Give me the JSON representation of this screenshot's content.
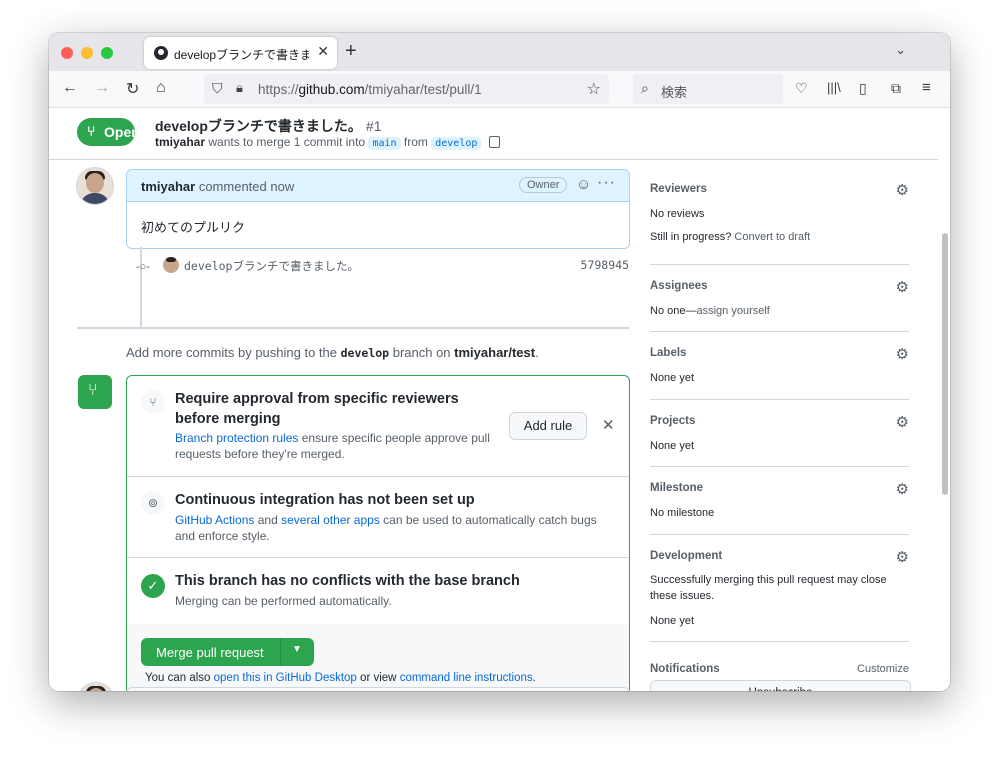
{
  "browser": {
    "tab_title": "developブランチで書きました。",
    "url_prefix": "https://",
    "url_host": "github.com",
    "url_path": "/tmiyahar/test/pull/1",
    "search_placeholder": "検索"
  },
  "pr": {
    "state": "Open",
    "title": "developブランチで書きました。",
    "number": "#1",
    "author": "tmiyahar",
    "meta_text": "wants to merge 1 commit into",
    "base_branch": "main",
    "from_text": "from",
    "head_branch": "develop"
  },
  "comment": {
    "author": "tmiyahar",
    "action": "commented now",
    "role": "Owner",
    "body": "初めてのプルリク"
  },
  "commit": {
    "message": "developブランチで書きました。",
    "sha": "5798945"
  },
  "push_note": {
    "prefix": "Add more commits by pushing to the",
    "branch": "develop",
    "middle": "branch on",
    "repo": "tmiyahar/test",
    "suffix": "."
  },
  "merge": {
    "approval_title": "Require approval from specific reviewers before merging",
    "approval_link": "Branch protection rules",
    "approval_desc": "ensure specific people approve pull requests before they're merged.",
    "add_rule": "Add rule",
    "ci_title": "Continuous integration has not been set up",
    "ci_link1": "GitHub Actions",
    "ci_and": "and",
    "ci_link2": "several other apps",
    "ci_desc": "can be used to automatically catch bugs and enforce style.",
    "conflict_title": "This branch has no conflicts with the base branch",
    "conflict_desc": "Merging can be performed automatically.",
    "merge_button": "Merge pull request",
    "alt_prefix": "You can also",
    "alt_link1": "open this in GitHub Desktop",
    "alt_middle": "or view",
    "alt_link2": "command line instructions",
    "alt_suffix": "."
  },
  "sidebar": {
    "reviewers_h": "Reviewers",
    "reviewers_v": "No reviews",
    "progress_text": "Still in progress?",
    "progress_link": "Convert to draft",
    "assignees_h": "Assignees",
    "assignees_v": "No one—",
    "assignees_link": "assign yourself",
    "labels_h": "Labels",
    "labels_v": "None yet",
    "projects_h": "Projects",
    "projects_v": "None yet",
    "milestone_h": "Milestone",
    "milestone_v": "No milestone",
    "development_h": "Development",
    "development_line1": "Successfully merging this pull request may close",
    "development_line2": "these issues.",
    "development_v": "None yet",
    "notifications_h": "Notifications",
    "customize": "Customize",
    "unsubscribe": "Unsubscribe"
  },
  "colors": {
    "accent_green": "#2da44e",
    "link_blue": "#0969da",
    "comment_header": "#ddf4ff"
  }
}
